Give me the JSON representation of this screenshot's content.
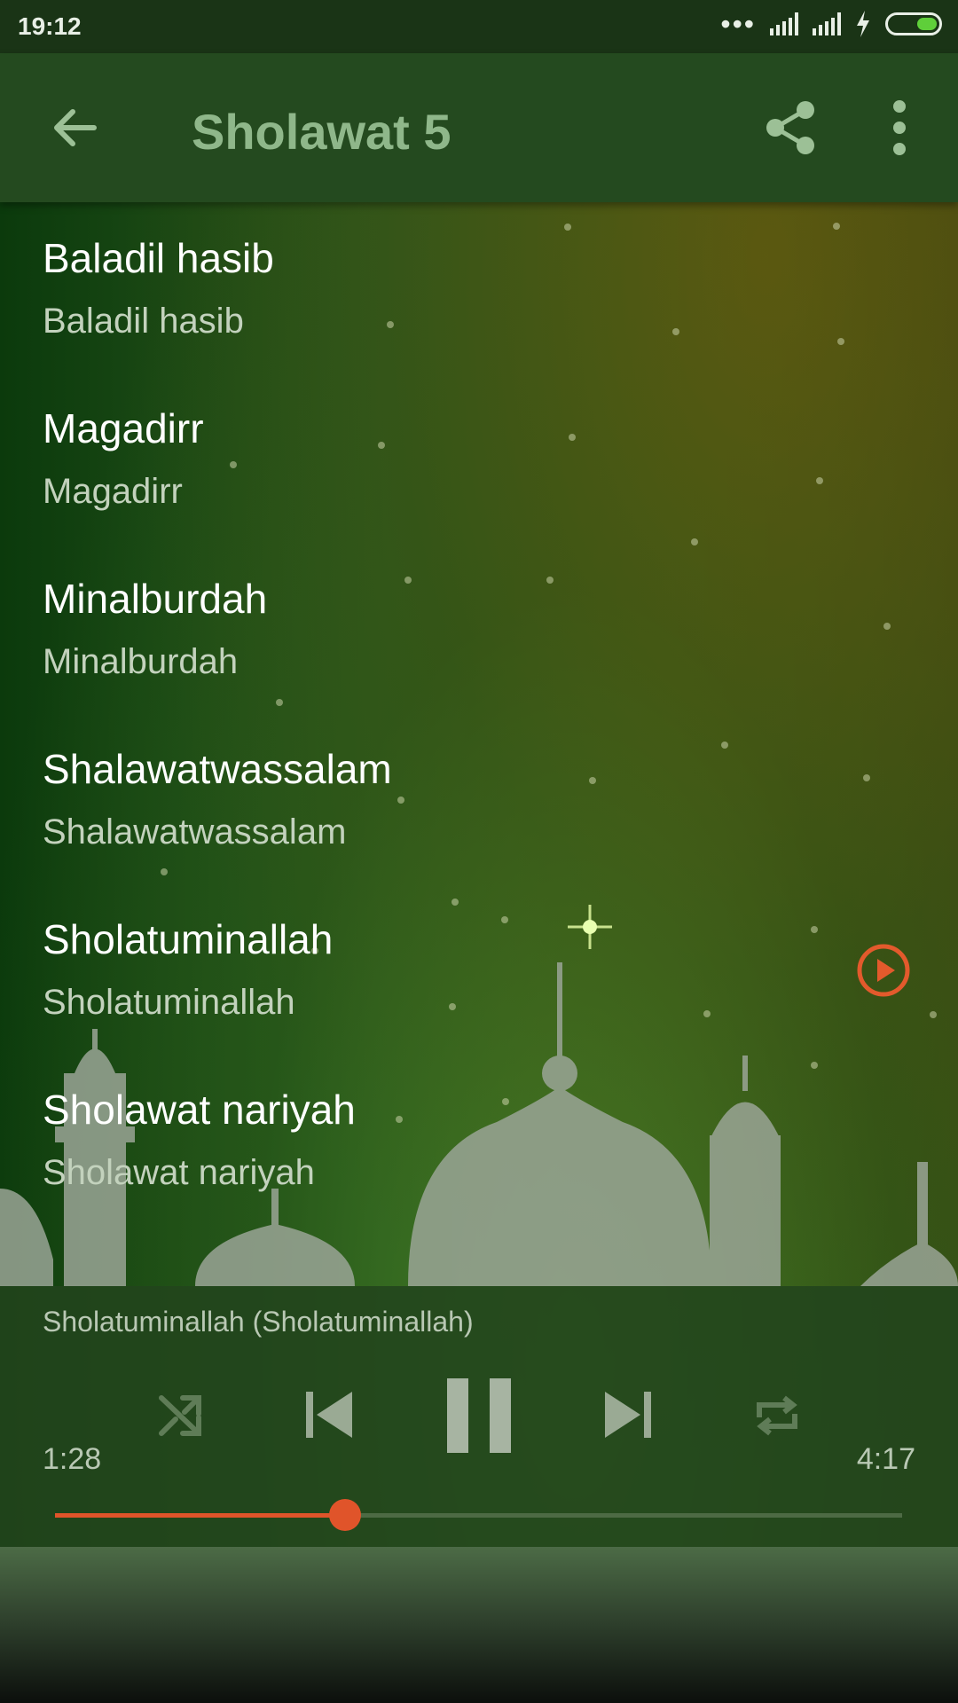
{
  "status_bar": {
    "time": "19:12"
  },
  "toolbar": {
    "title": "Sholawat 5",
    "icons": {
      "back": "arrow-back-icon",
      "share": "share-icon",
      "more": "more-vert-icon"
    }
  },
  "tracks": [
    {
      "title": "Baladil hasib",
      "subtitle": "Baladil hasib"
    },
    {
      "title": "Magadirr",
      "subtitle": "Magadirr"
    },
    {
      "title": "Minalburdah",
      "subtitle": "Minalburdah"
    },
    {
      "title": "Shalawatwassalam",
      "subtitle": "Shalawatwassalam"
    },
    {
      "title": "Sholatuminallah",
      "subtitle": "Sholatuminallah",
      "playing": true
    },
    {
      "title": "Sholawat nariyah",
      "subtitle": "Sholawat nariyah"
    }
  ],
  "player": {
    "now_playing": "Sholatuminallah (Sholatuminallah)",
    "current_time": "1:28",
    "duration": "4:17",
    "progress_fraction": 0.342,
    "controls": [
      "shuffle-icon",
      "skip-previous-icon",
      "pause-icon",
      "skip-next-icon",
      "repeat-icon"
    ]
  },
  "colors": {
    "accent": "#e0542a",
    "toolbar": "#244a1f",
    "title_text": "#8fb78a"
  }
}
